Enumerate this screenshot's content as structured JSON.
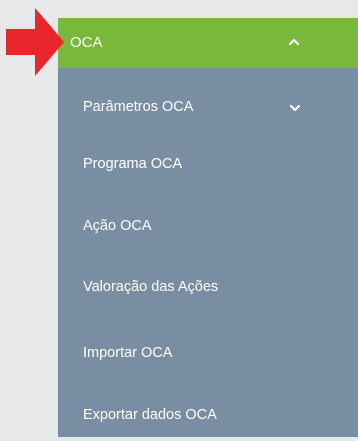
{
  "menu": {
    "header": {
      "label": "OCA",
      "chevron_icon": "chevron-up-icon",
      "expanded": true
    },
    "items": [
      {
        "label": "Parâmetros OCA",
        "has_submenu": true,
        "chevron_icon": "chevron-down-icon"
      },
      {
        "label": "Programa OCA"
      },
      {
        "label": "Ação OCA"
      },
      {
        "label": "Valoração das Ações"
      },
      {
        "label": "Importar OCA"
      },
      {
        "label": "Exportar dados OCA"
      }
    ]
  },
  "annotation": {
    "icon": "arrow-right-icon",
    "color": "#e8262b"
  },
  "colors": {
    "header_bg": "#78b83a",
    "menu_bg": "#7a8ea3",
    "page_bg": "#e6e8ea",
    "text": "#ffffff"
  }
}
